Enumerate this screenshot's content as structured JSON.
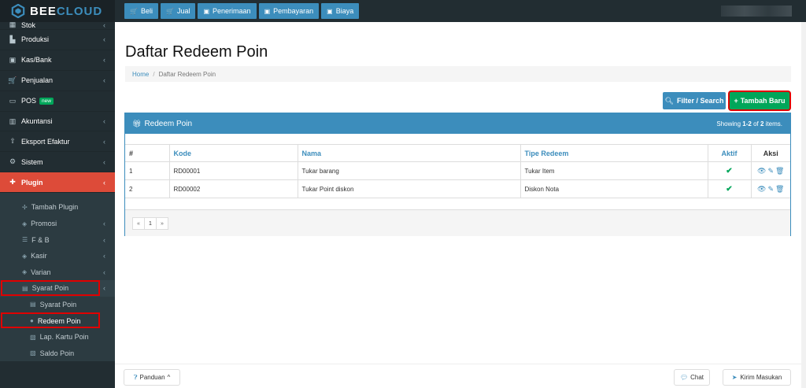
{
  "brand": {
    "name_a": "BEE",
    "name_b": "CLOUD"
  },
  "topnav": [
    {
      "icon": "cart-icon",
      "label": "Beli"
    },
    {
      "icon": "cart-icon",
      "label": "Jual"
    },
    {
      "icon": "money-icon",
      "label": "Penerimaan"
    },
    {
      "icon": "money-icon",
      "label": "Pembayaran"
    },
    {
      "icon": "money-icon",
      "label": "Biaya"
    }
  ],
  "sidebar": {
    "items": [
      {
        "label": "Stok",
        "icon": "box-icon"
      },
      {
        "label": "Produksi",
        "icon": "factory-icon"
      },
      {
        "label": "Kas/Bank",
        "icon": "money-icon"
      },
      {
        "label": "Penjualan",
        "icon": "cart-icon"
      },
      {
        "label": "POS",
        "icon": "monitor-icon",
        "badge": "new"
      },
      {
        "label": "Akuntansi",
        "icon": "chart-icon"
      },
      {
        "label": "Eksport Efaktur",
        "icon": "export-icon"
      },
      {
        "label": "Sistem",
        "icon": "gears-icon"
      },
      {
        "label": "Plugin",
        "icon": "puzzle-icon"
      }
    ],
    "plugin_sub": [
      {
        "label": "Tambah Plugin",
        "icon": "plus-icon"
      },
      {
        "label": "Promosi",
        "icon": "tag-icon"
      },
      {
        "label": "F & B",
        "icon": "list-icon"
      },
      {
        "label": "Kasir",
        "icon": "tag-icon"
      },
      {
        "label": "Varian",
        "icon": "tag-icon"
      },
      {
        "label": "Syarat Poin",
        "icon": "card-icon"
      }
    ],
    "syarat_sub": [
      {
        "label": "Syarat Poin",
        "icon": "card-icon"
      },
      {
        "label": "Redeem Poin",
        "icon": "gift-icon"
      },
      {
        "label": "Lap. Kartu Poin",
        "icon": "book-icon"
      },
      {
        "label": "Saldo Poin",
        "icon": "book-icon"
      }
    ]
  },
  "page": {
    "title": "Daftar Redeem Poin",
    "breadcrumb": {
      "home": "Home",
      "separator": "/",
      "current": "Daftar Redeem Poin"
    },
    "filter_button": "Filter / Search",
    "add_button": "Tambah Baru"
  },
  "panel": {
    "title": "Redeem Poin",
    "summary_prefix": "Showing ",
    "summary_range": "1-2",
    "summary_mid": " of ",
    "summary_total": "2",
    "summary_suffix": " items."
  },
  "table": {
    "headers": {
      "num": "#",
      "kode": "Kode",
      "nama": "Nama",
      "tipe": "Tipe Redeem",
      "aktif": "Aktif",
      "aksi": "Aksi"
    },
    "rows": [
      {
        "num": "1",
        "kode": "RD00001",
        "nama": "Tukar barang",
        "tipe": "Tukar Item"
      },
      {
        "num": "2",
        "kode": "RD00002",
        "nama": "Tukar Point diskon",
        "tipe": "Diskon Nota"
      }
    ]
  },
  "pager": {
    "prev": "«",
    "page": "1",
    "next": "»"
  },
  "footer": {
    "panduan": "Panduan",
    "chat": "Chat",
    "kirim": "Kirim Masukan"
  },
  "colors": {
    "primary": "#3c8dbc",
    "success": "#00a65a",
    "danger": "#dd4b39",
    "sidebar": "#222d32",
    "highlight": "#e00000"
  }
}
